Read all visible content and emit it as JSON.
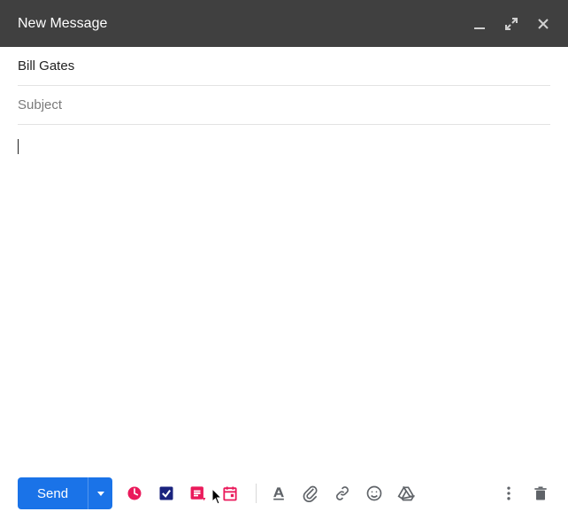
{
  "titlebar": {
    "title": "New Message"
  },
  "fields": {
    "to_value": "Bill Gates",
    "subject_placeholder": "Subject",
    "subject_value": ""
  },
  "body": {
    "text": ""
  },
  "toolbar": {
    "send_label": "Send"
  },
  "colors": {
    "header_bg": "#404040",
    "accent_pink": "#ea1a5b",
    "accent_navy": "#1a237e",
    "send_blue": "#1a73e8",
    "icon_gray": "#5f6368"
  }
}
